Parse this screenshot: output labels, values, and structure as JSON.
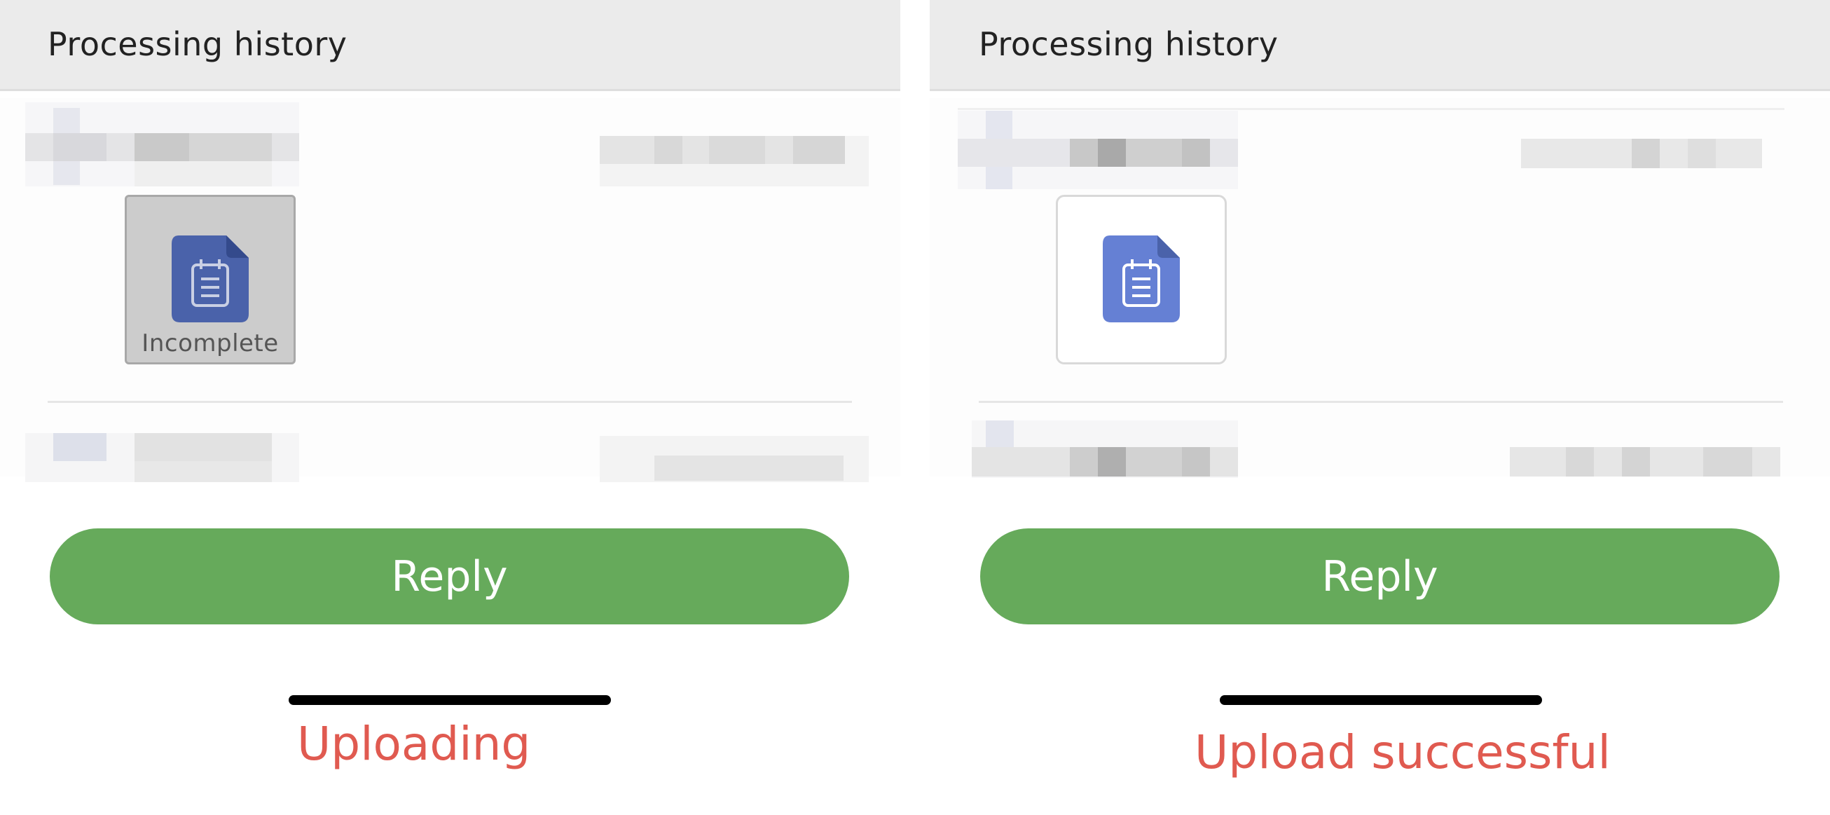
{
  "panels": [
    {
      "id": "uploading",
      "header_title": "Processing history",
      "tile_status": "Incomplete",
      "reply_label": "Reply",
      "caption": "Uploading"
    },
    {
      "id": "upload_successful",
      "header_title": "Processing history",
      "tile_status": "",
      "reply_label": "Reply",
      "caption": "Upload successful"
    }
  ],
  "icons": {
    "file_icon": "clipboard-document-icon"
  },
  "colors": {
    "header_bg": "#ebebeb",
    "reply_button": "#66aa5b",
    "caption": "#e05a50",
    "file_icon_uploading": "#4a62aa",
    "file_icon_done": "#6580d4",
    "tile_uploading_bg": "#cccccc"
  }
}
